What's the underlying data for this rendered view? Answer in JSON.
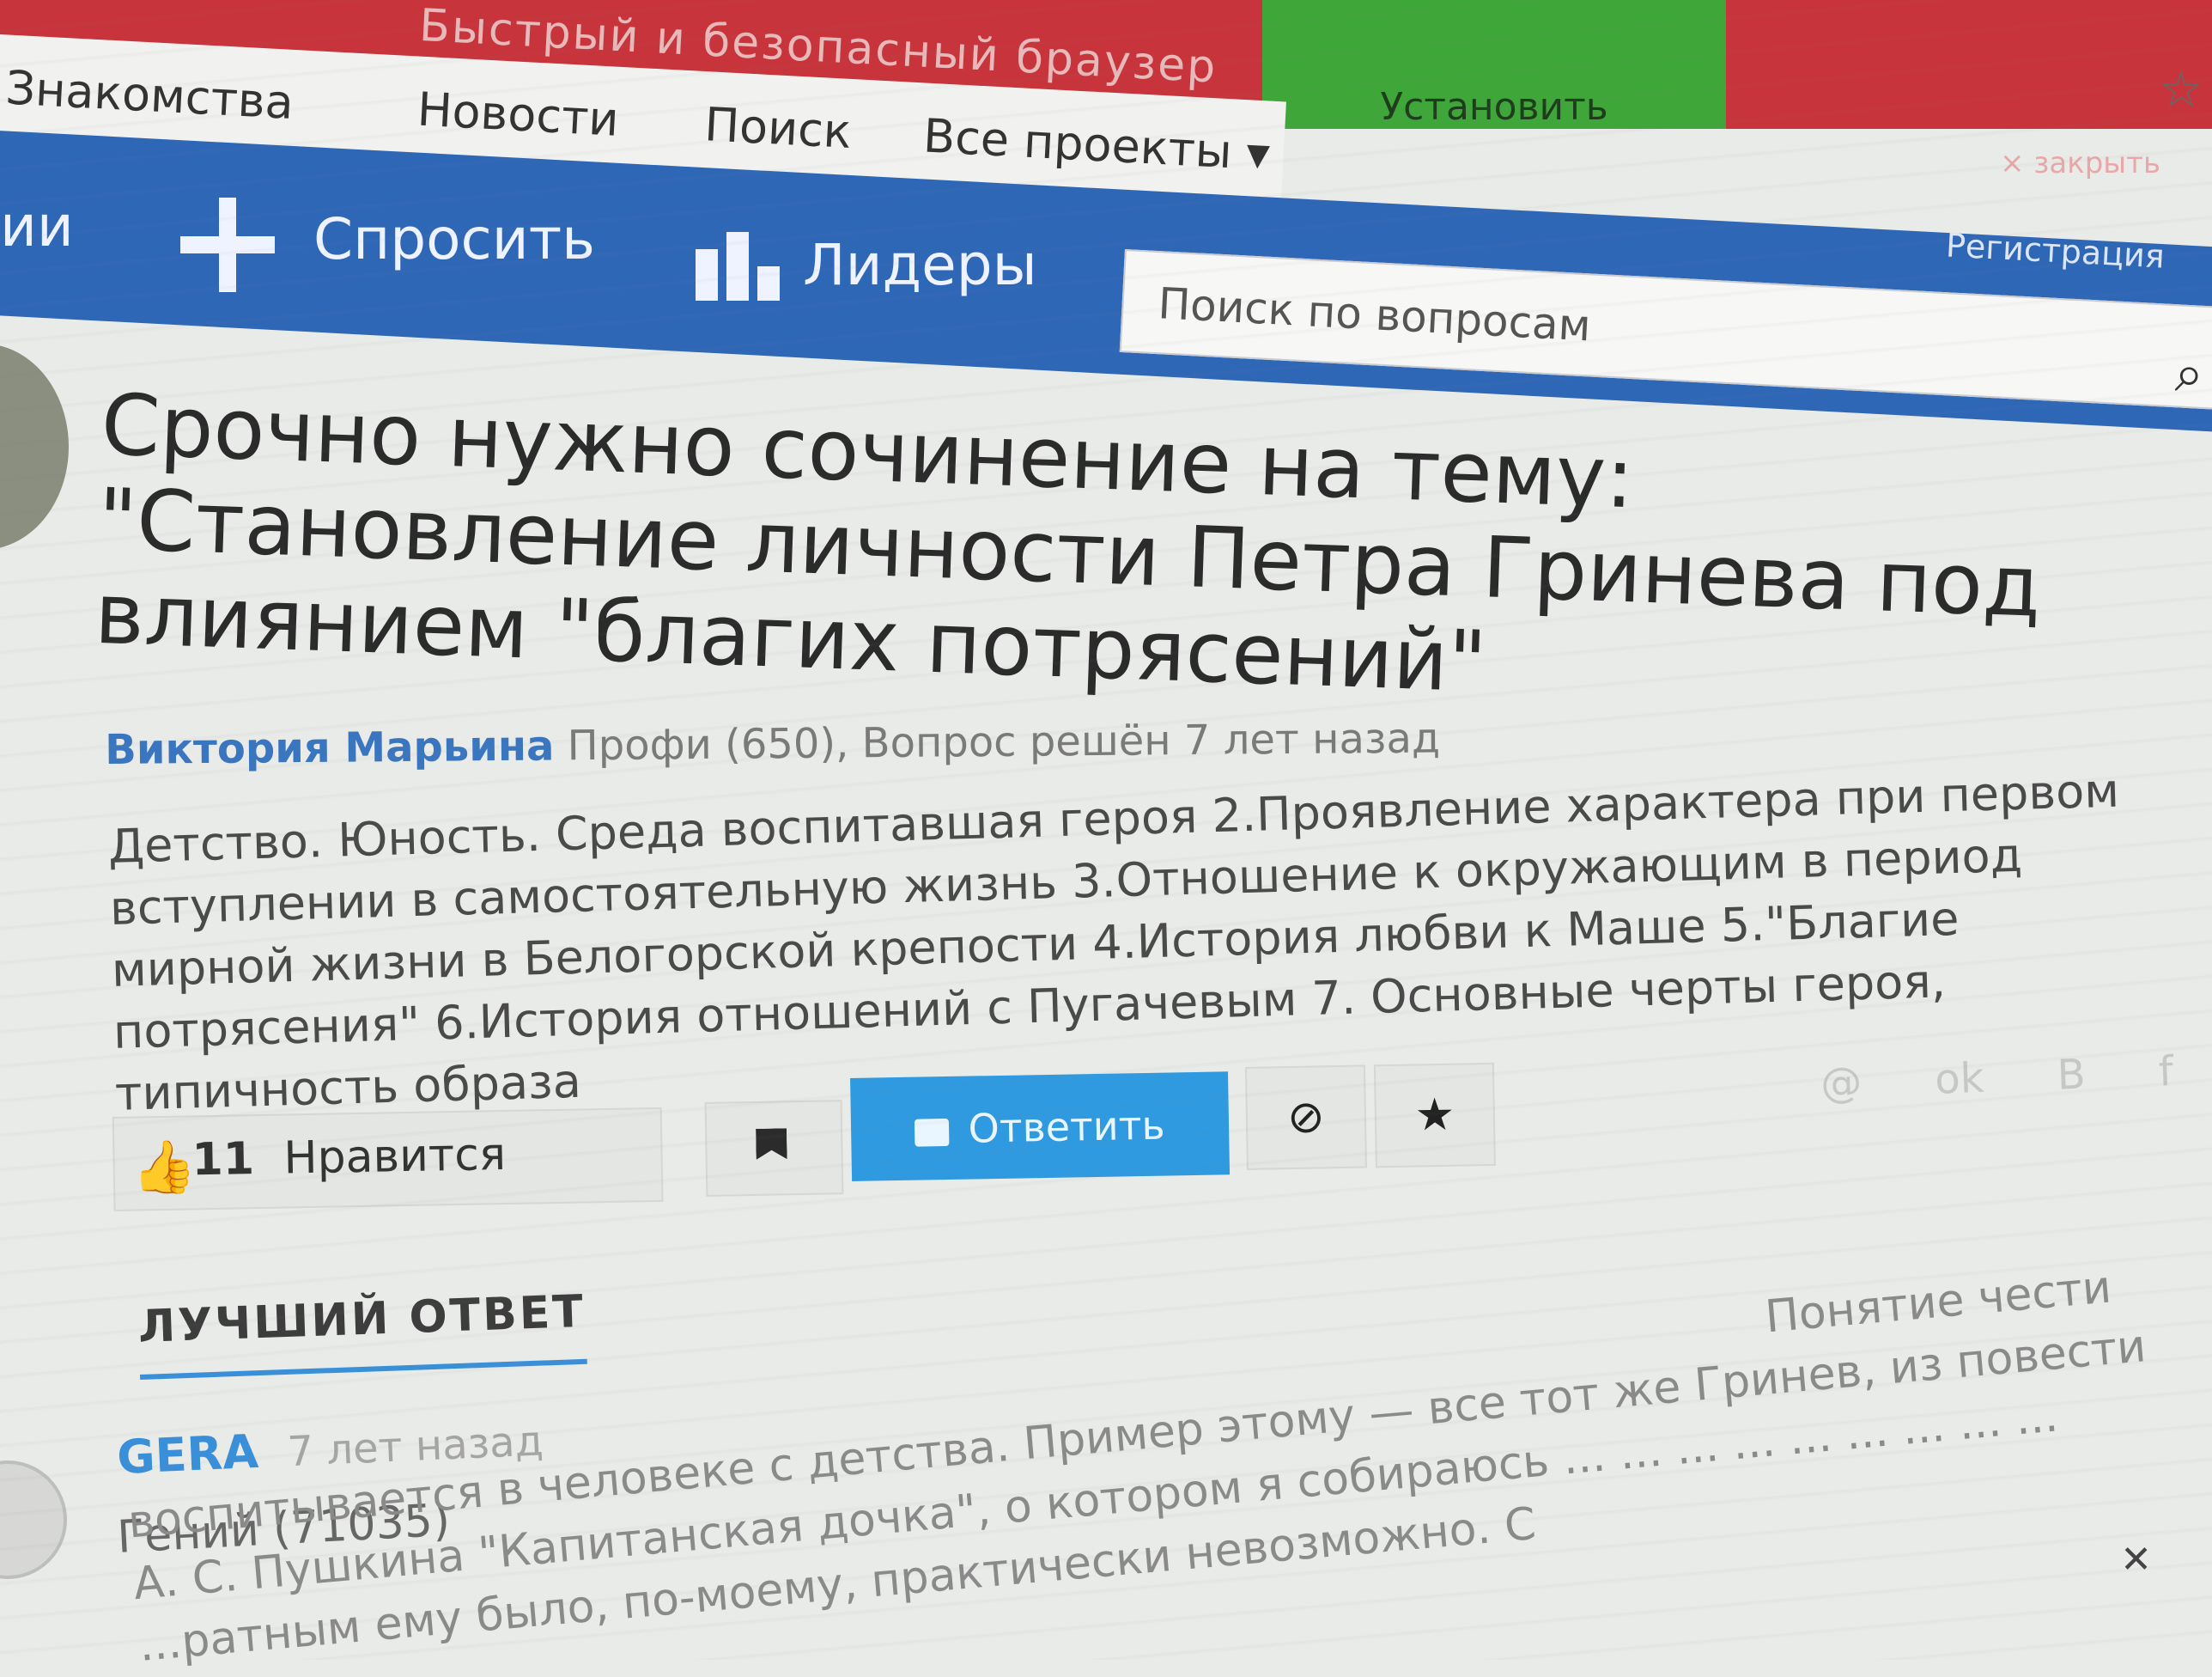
{
  "promo": {
    "text": "Быстрый и безопасный браузер",
    "install_label": "Установить",
    "close_label": "× закрыть"
  },
  "top_nav": {
    "items": [
      "Знакомства",
      "Новости",
      "Поиск",
      "Все проекты ▾"
    ]
  },
  "header": {
    "partial_label": "ии",
    "ask_label": "Спросить",
    "leaders_label": "Лидеры",
    "search_placeholder": "Поиск по вопросам",
    "register_label": "Регистрация"
  },
  "question": {
    "title": "Срочно нужно сочинение на тему: \"Становление личности Петра Гринева под влиянием \"благих потрясений\"",
    "author": "Виктория Марьина",
    "meta": "Профи (650), Вопрос решён 7 лет назад",
    "body": "Детство. Юность. Среда воспитавшая героя 2.Проявление характера при первом вступлении в самостоятельную жизнь 3.Отношение к окружающим в период мирной жизни в Белогорской крепости 4.История любви к Маше 5.\"Благие потрясения\" 6.История отношений с Пугачевым 7. Основные черты героя, типичность образа"
  },
  "actions": {
    "like_count": "11",
    "like_label": "Нравится",
    "reply_label": "Ответить",
    "ban_symbol": "⊘",
    "fav_symbol": "★"
  },
  "share": {
    "icons": [
      "@",
      "ok",
      "В",
      "f"
    ]
  },
  "best_answer": {
    "tab_label": "ЛУЧШИЙ ОТВЕТ",
    "author": "GERA",
    "time": "7 лет назад",
    "rank": "Гений (71035)",
    "body": "Понятие чести воспитывается в человеке с детства. Пример этому — все тот же Гринев, из повести А. С. Пушкина \"Капитанская дочка\", о котором я собираюсь ... ... ... ... ... ... ... ... ... ...ратным ему было, по-моему, практически невозможно. С"
  }
}
